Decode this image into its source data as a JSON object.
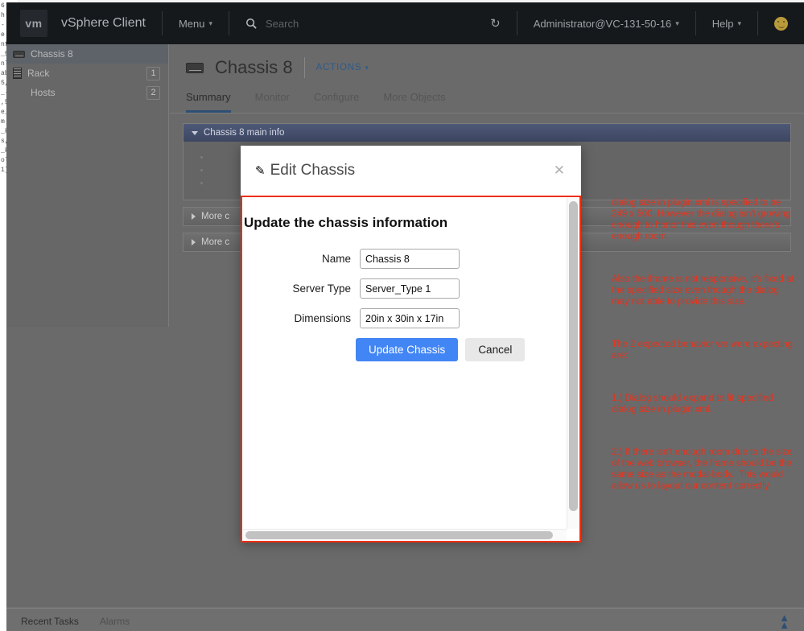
{
  "background_editor_lines": [
    "6",
    "h",
    "-",
    "e",
    "nt",
    "_5",
    "nl",
    "ab",
    "5,",
    "_-",
    ",5",
    "e_",
    "m",
    "_k",
    "s,",
    "_k",
    "ol",
    "1]"
  ],
  "topnav": {
    "logo_text": "vm",
    "brand": "vSphere Client",
    "menu_label": "Menu",
    "search_placeholder": "Search",
    "refresh_icon": "refresh-icon",
    "user": "Administrator@VC-131-50-16",
    "help_label": "Help",
    "avatar_icon": "smiley-face-icon"
  },
  "sidebar": {
    "items": [
      {
        "label": "Chassis 8",
        "icon": "chassis-icon",
        "count": "",
        "selected": true
      },
      {
        "label": "Rack",
        "icon": "rack-icon",
        "count": "1",
        "selected": false
      },
      {
        "label": "Hosts",
        "icon": "",
        "count": "2",
        "selected": false
      }
    ]
  },
  "main": {
    "page_icon": "chassis-icon",
    "page_title": "Chassis 8",
    "actions_label": "ACTIONS",
    "tabs": [
      {
        "label": "Summary",
        "active": true
      },
      {
        "label": "Monitor",
        "active": false
      },
      {
        "label": "Configure",
        "active": false
      },
      {
        "label": "More Objects",
        "active": false
      }
    ],
    "panels": [
      {
        "title": "Chassis 8 main info",
        "expanded": true,
        "bullets": [
          "",
          "",
          ""
        ]
      },
      {
        "title": "More c",
        "expanded": false,
        "bullets": []
      },
      {
        "title": "More c",
        "expanded": false,
        "bullets": []
      }
    ]
  },
  "annotations": {
    "color": "#e0341f",
    "paragraphs": [
      "dialog size in plugin.xml is specified to be 249 x 500. However the dialog isn't growing enough to honor this even though there's enough room.",
      "Also the iframe is not responsive, it's fixed at the specified size even though the dialog may not able to provide this size.",
      "The 2 expected behavior we were expecting are:",
      "1.) Dialog should expand to fit specified dialog size in plugin.xml.",
      "2.) If there isn't enough room due to the size of the web browser, the frame should be the same size as the modal-body.  This would allow us to layout our content correctly."
    ]
  },
  "modal": {
    "pencil_icon": "pencil-icon",
    "title": "Edit Chassis",
    "close_icon": "close-icon",
    "frame_border_color": "#ee2f12",
    "heading": "Update the chassis information",
    "fields": [
      {
        "label": "Name",
        "value": "Chassis 8",
        "name": "name-field"
      },
      {
        "label": "Server Type",
        "value": "Server_Type 1",
        "name": "server-type-field"
      },
      {
        "label": "Dimensions",
        "value": "20in x 30in x 17in",
        "name": "dimensions-field"
      }
    ],
    "primary_button": "Update Chassis",
    "secondary_button": "Cancel",
    "primary_button_color": "#4285f4"
  },
  "taskbar": {
    "recent_tasks": "Recent Tasks",
    "alarms": "Alarms",
    "expand_icon": "double-chevron-up-icon"
  }
}
